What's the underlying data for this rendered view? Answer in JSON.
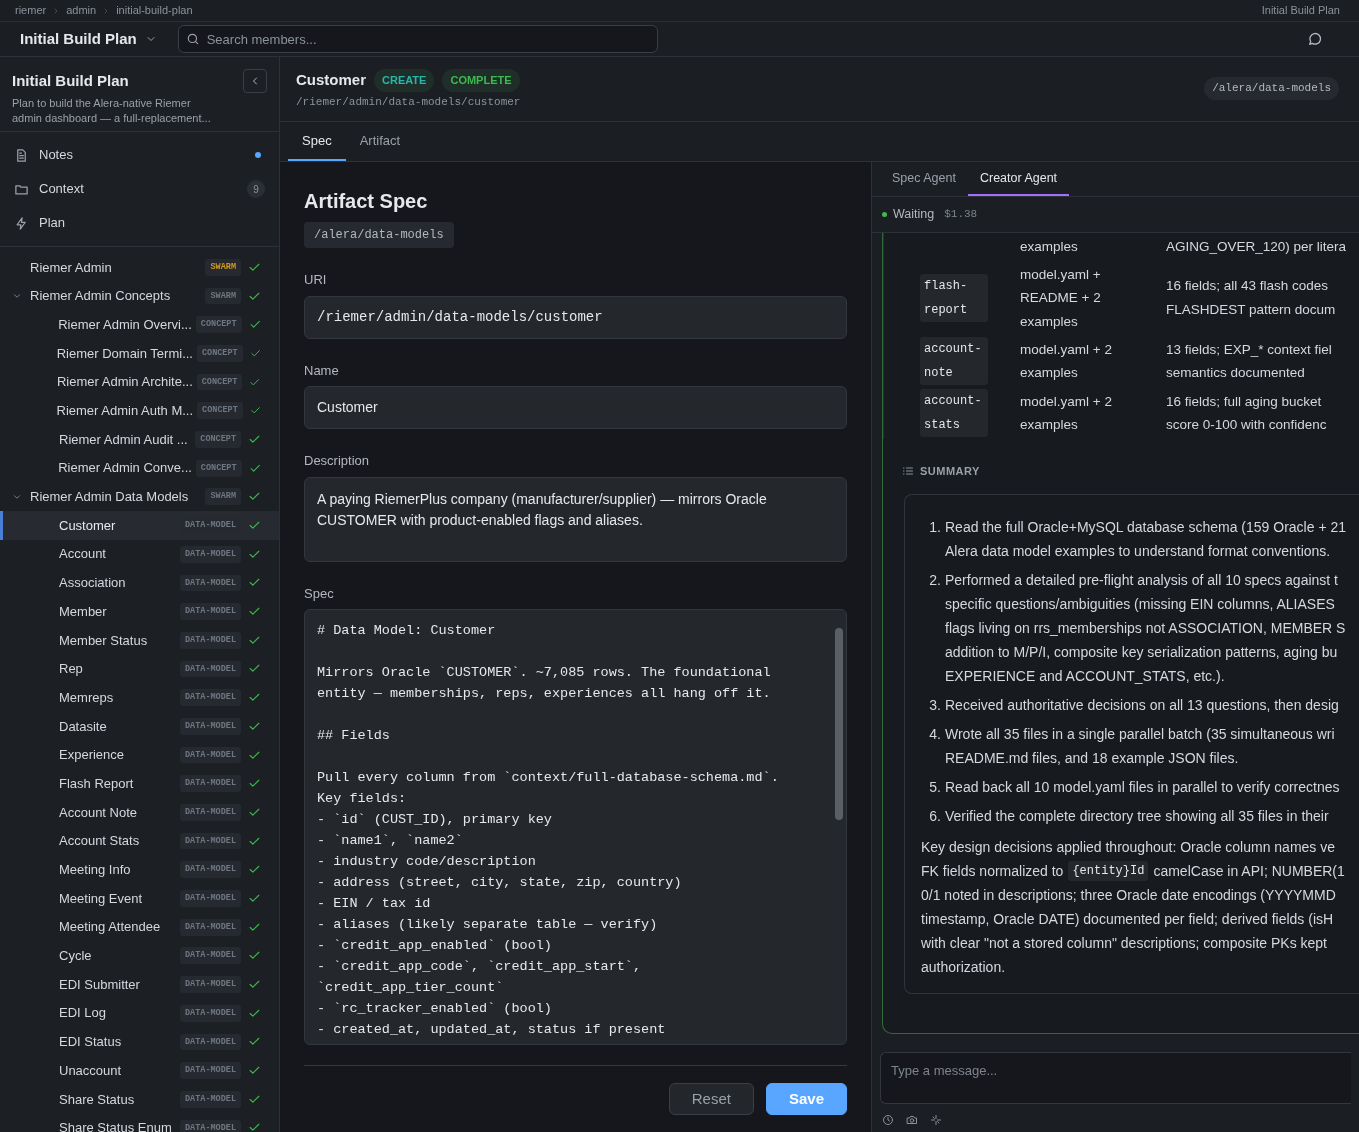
{
  "breadcrumb": {
    "items": [
      "riemer",
      "admin",
      "initial-build-plan"
    ],
    "right_label": "Initial Build Plan"
  },
  "header": {
    "project": "Initial Build Plan",
    "search": {
      "placeholder": "Search members..."
    }
  },
  "sidebar": {
    "title": "Initial Build Plan",
    "description": "Plan to build the Alera-native Riemer admin dashboard — a full-replacement...",
    "nav": [
      {
        "kind": "notes",
        "label": "Notes",
        "dot": true
      },
      {
        "kind": "context",
        "label": "Context",
        "count": "9"
      },
      {
        "kind": "plan",
        "label": "Plan"
      }
    ],
    "tree": [
      {
        "label": "Riemer Admin",
        "tag": "SWARM",
        "color": "#d29922",
        "done": true,
        "selected": false
      },
      {
        "label": "Riemer Admin Concepts",
        "tag": "SWARM",
        "color": "#6e7681",
        "done": true,
        "selected": false,
        "expanded": true,
        "children": [
          {
            "label": "Riemer Admin Overvi...",
            "tag": "CONCEPT",
            "color": "#6e7681",
            "done": true,
            "selected": false
          },
          {
            "label": "Riemer Domain Termi...",
            "tag": "CONCEPT",
            "color": "#6e7681",
            "done": true,
            "selected": false
          },
          {
            "label": "Riemer Admin Archite...",
            "tag": "CONCEPT",
            "color": "#6e7681",
            "done": true,
            "selected": false
          },
          {
            "label": "Riemer Admin Auth M...",
            "tag": "CONCEPT",
            "color": "#6e7681",
            "done": true,
            "selected": false
          },
          {
            "label": "Riemer Admin Audit ...",
            "tag": "CONCEPT",
            "color": "#6e7681",
            "done": true,
            "selected": false
          },
          {
            "label": "Riemer Admin Conve...",
            "tag": "CONCEPT",
            "color": "#6e7681",
            "done": true,
            "selected": false
          }
        ]
      },
      {
        "label": "Riemer Admin Data Models",
        "tag": "SWARM",
        "color": "#6e7681",
        "done": true,
        "selected": false,
        "expanded": true,
        "children": [
          {
            "label": "Customer",
            "tag": "DATA-MODEL",
            "color": "#6e7681",
            "done": true,
            "selected": true
          },
          {
            "label": "Account",
            "tag": "DATA-MODEL",
            "color": "#6e7681",
            "done": true,
            "selected": false
          },
          {
            "label": "Association",
            "tag": "DATA-MODEL",
            "color": "#6e7681",
            "done": true,
            "selected": false
          },
          {
            "label": "Member",
            "tag": "DATA-MODEL",
            "color": "#6e7681",
            "done": true,
            "selected": false
          },
          {
            "label": "Member Status",
            "tag": "DATA-MODEL",
            "color": "#6e7681",
            "done": true,
            "selected": false
          },
          {
            "label": "Rep",
            "tag": "DATA-MODEL",
            "color": "#6e7681",
            "done": true,
            "selected": false
          },
          {
            "label": "Memreps",
            "tag": "DATA-MODEL",
            "color": "#6e7681",
            "done": true,
            "selected": false
          },
          {
            "label": "Datasite",
            "tag": "DATA-MODEL",
            "color": "#6e7681",
            "done": true,
            "selected": false
          },
          {
            "label": "Experience",
            "tag": "DATA-MODEL",
            "color": "#6e7681",
            "done": true,
            "selected": false
          },
          {
            "label": "Flash Report",
            "tag": "DATA-MODEL",
            "color": "#6e7681",
            "done": true,
            "selected": false
          },
          {
            "label": "Account Note",
            "tag": "DATA-MODEL",
            "color": "#6e7681",
            "done": true,
            "selected": false
          },
          {
            "label": "Account Stats",
            "tag": "DATA-MODEL",
            "color": "#6e7681",
            "done": true,
            "selected": false
          },
          {
            "label": "Meeting Info",
            "tag": "DATA-MODEL",
            "color": "#6e7681",
            "done": true,
            "selected": false
          },
          {
            "label": "Meeting Event",
            "tag": "DATA-MODEL",
            "color": "#6e7681",
            "done": true,
            "selected": false
          },
          {
            "label": "Meeting Attendee",
            "tag": "DATA-MODEL",
            "color": "#6e7681",
            "done": true,
            "selected": false
          },
          {
            "label": "Cycle",
            "tag": "DATA-MODEL",
            "color": "#6e7681",
            "done": true,
            "selected": false
          },
          {
            "label": "EDI Submitter",
            "tag": "DATA-MODEL",
            "color": "#6e7681",
            "done": true,
            "selected": false
          },
          {
            "label": "EDI Log",
            "tag": "DATA-MODEL",
            "color": "#6e7681",
            "done": true,
            "selected": false
          },
          {
            "label": "EDI Status",
            "tag": "DATA-MODEL",
            "color": "#6e7681",
            "done": true,
            "selected": false
          },
          {
            "label": "Unaccount",
            "tag": "DATA-MODEL",
            "color": "#6e7681",
            "done": true,
            "selected": false
          },
          {
            "label": "Share Status",
            "tag": "DATA-MODEL",
            "color": "#6e7681",
            "done": true,
            "selected": false
          },
          {
            "label": "Share Status Enum",
            "tag": "DATA-MODEL",
            "color": "#6e7681",
            "done": true,
            "selected": false
          }
        ]
      }
    ]
  },
  "artifact": {
    "title": "Customer",
    "badges": [
      {
        "label": "CREATE",
        "color": "#2bb5a8"
      },
      {
        "label": "COMPLETE",
        "color": "#3fb950"
      }
    ],
    "path": "/riemer/admin/data-models/customer",
    "location": "/alera/data-models"
  },
  "tabs": [
    {
      "label": "Spec",
      "selected": true
    },
    {
      "label": "Artifact",
      "selected": false
    }
  ],
  "form": {
    "heading": "Artifact Spec",
    "location": "/alera/data-models",
    "fields": [
      {
        "kind": "input",
        "label": "URI",
        "value": "/riemer/admin/data-models/customer",
        "mono": true
      },
      {
        "kind": "input",
        "label": "Name",
        "value": "Customer",
        "mono": false
      },
      {
        "kind": "textarea",
        "label": "Description",
        "value": "A paying RiemerPlus company (manufacturer/supplier) — mirrors Oracle CUSTOMER with product-enabled flags and aliases.",
        "mono": false
      },
      {
        "kind": "editor",
        "label": "Spec",
        "value": "# Data Model: Customer\n\nMirrors Oracle `CUSTOMER`. ~7,085 rows. The foundational\nentity — memberships, reps, experiences all hang off it.\n\n## Fields\n\nPull every column from `context/full-database-schema.md`.\nKey fields:\n- `id` (CUST_ID), primary key\n- `name1`, `name2`\n- industry code/description\n- address (street, city, state, zip, country)\n- EIN / tax id\n- aliases (likely separate table — verify)\n- `credit_app_enabled` (bool)\n- `credit_app_code`, `credit_app_start`,\n`credit_app_tier_count`\n- `rc_tracker_enabled` (bool)\n- created_at, updated_at, status if present",
        "mono": true
      }
    ],
    "buttons": [
      {
        "kind": "secondary",
        "label": "Reset"
      },
      {
        "kind": "primary",
        "label": "Save"
      }
    ]
  },
  "agent": {
    "tabs": [
      {
        "label": "Spec Agent",
        "selected": false
      },
      {
        "label": "Creator Agent",
        "selected": true
      }
    ],
    "status": {
      "label": "Waiting",
      "color": "#3fb950",
      "cost": "$1.38"
    },
    "table_rows": [
      {
        "code": null,
        "files": [
          "examples"
        ],
        "notes": [
          "AGING_OVER_120) per litera"
        ]
      },
      {
        "code": "flash-report",
        "files": [
          "model.yaml +",
          "README + 2",
          "examples"
        ],
        "notes": [
          "16 fields; all 43 flash codes",
          "FLASHDEST pattern docum"
        ]
      },
      {
        "code": "account-note",
        "files": [
          "model.yaml + 2",
          "examples"
        ],
        "notes": [
          "13 fields; EXP_* context fiel",
          "semantics documented"
        ]
      },
      {
        "code": "account-stats",
        "files": [
          "model.yaml + 2",
          "examples"
        ],
        "notes": [
          "16 fields; full aging bucket",
          "score 0-100 with confidenc"
        ]
      }
    ],
    "summary_heading": "SUMMARY",
    "steps": [
      {
        "number": "1.",
        "lines": [
          "Read the full Oracle+MySQL database schema (159 Oracle + 21",
          "Alera data model examples to understand format conventions."
        ]
      },
      {
        "number": "2.",
        "lines": [
          "Performed a detailed pre-flight analysis of all 10 specs against t",
          "specific questions/ambiguities (missing EIN columns, ALIASES",
          "flags living on rrs_memberships not ASSOCIATION, MEMBER S",
          "addition to M/P/I, composite key serialization patterns, aging bu",
          "EXPERIENCE and ACCOUNT_STATS, etc.)."
        ]
      },
      {
        "number": "3.",
        "lines": [
          "Received authoritative decisions on all 13 questions, then desig"
        ]
      },
      {
        "number": "4.",
        "lines": [
          "Wrote all 35 files in a single parallel batch (35 simultaneous wri",
          "README.md files, and 18 example JSON files."
        ]
      },
      {
        "number": "5.",
        "lines": [
          "Read back all 10 model.yaml files in parallel to verify correctnes"
        ]
      },
      {
        "number": "6.",
        "lines": [
          "Verified the complete directory tree showing all 35 files in their"
        ]
      }
    ],
    "notes": [
      [
        {
          "kind": "text",
          "text": "Key design decisions applied throughout: Oracle column names ve"
        }
      ],
      [
        {
          "kind": "text",
          "text": "FK fields normalized to"
        },
        {
          "kind": "code",
          "text": "{entity}Id"
        },
        {
          "kind": "text",
          "text": "camelCase in API; NUMBER(1"
        }
      ],
      [
        {
          "kind": "text",
          "text": "0/1 noted in descriptions; three Oracle date encodings (YYYYMMD"
        }
      ],
      [
        {
          "kind": "text",
          "text": "timestamp, Oracle DATE) documented per field; derived fields (isH"
        }
      ],
      [
        {
          "kind": "text",
          "text": "with clear \"not a stored column\" descriptions; composite PKs kept"
        }
      ],
      [
        {
          "kind": "text",
          "text": "authorization."
        }
      ]
    ],
    "message": {
      "placeholder": "Type a message..."
    }
  }
}
